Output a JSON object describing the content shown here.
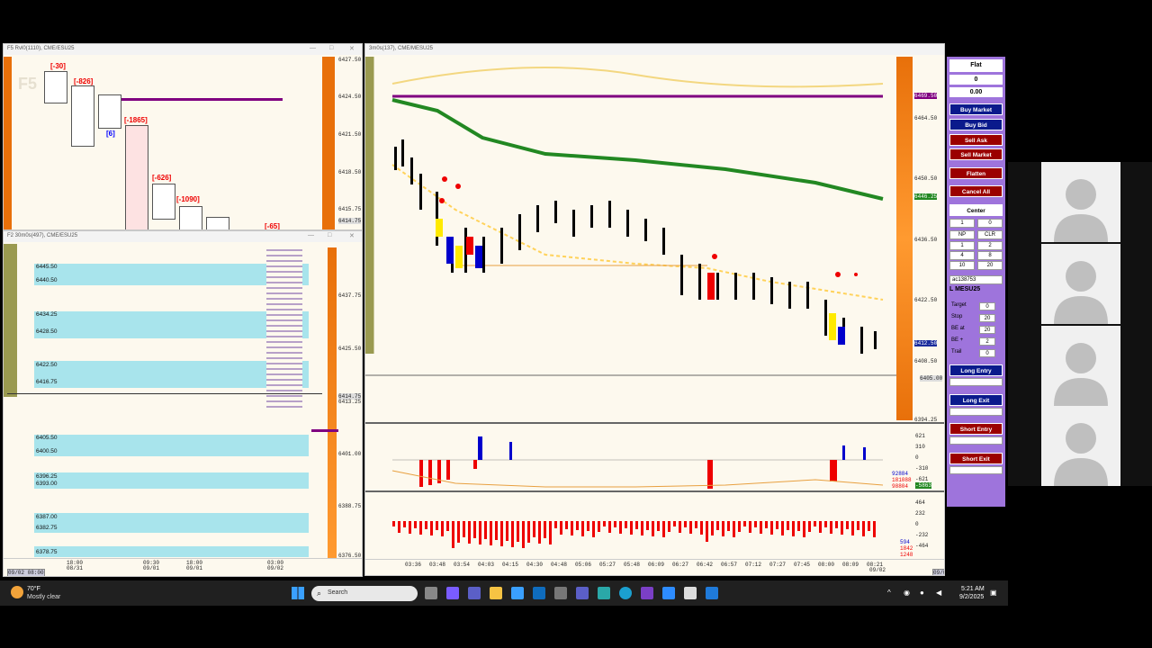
{
  "windows": {
    "left_top": {
      "title": "F5 Rvl0(1110), CME/ESU25",
      "watermark": "F5",
      "prices": [
        "6427.50",
        "6424.50",
        "6421.50",
        "6418.50",
        "6415.75",
        "6414.75"
      ],
      "labels": [
        "[-30]",
        "[-826]",
        "[-1865]",
        "[6]",
        "[-626]",
        "[-1090]",
        "[-65]"
      ]
    },
    "left_bottom": {
      "title": "F2 30m0s(497), CME/ESU25",
      "bands": [
        "6445.50",
        "6440.50",
        "6434.25",
        "6428.50",
        "6422.50",
        "6416.75",
        "6405.50",
        "6400.50",
        "6396.25",
        "6393.00",
        "6387.00",
        "6382.75",
        "6378.75"
      ],
      "prices": [
        "6437.75",
        "6425.50",
        "6414.75",
        "6413.25",
        "6401.00",
        "6388.75",
        "6376.50"
      ],
      "time_labels": [
        {
          "t": "18:00",
          "d": "08/31"
        },
        {
          "t": "09:30",
          "d": "09/01"
        },
        {
          "t": "18:00",
          "d": "09/01"
        },
        {
          "t": "03:00",
          "d": "09/02"
        }
      ],
      "date_box": "09/02 08:00"
    },
    "main": {
      "title": "3m0s(137), CME/MESU25",
      "prices": [
        "6469.50",
        "6464.50",
        "6450.50",
        "6446.25",
        "6436.50",
        "6422.50",
        "6412.50",
        "6408.50",
        "6405.00",
        "6394.25"
      ],
      "vol_axis": [
        "621",
        "310",
        "0",
        "-310",
        "-621"
      ],
      "vol_values": [
        "92884",
        "181088",
        "98804",
        "-5863"
      ],
      "delta_axis": [
        "464",
        "232",
        "0",
        "-232",
        "-464"
      ],
      "delta_values": [
        "594",
        "1842",
        "1248"
      ],
      "time_labels": [
        "03:36",
        "03:48",
        "03:54",
        "04:03",
        "04:15",
        "04:30",
        "04:48",
        "05:06",
        "05:27",
        "05:48",
        "06:09",
        "06:27",
        "06:42",
        "06:57",
        "07:12",
        "07:27",
        "07:45",
        "08:00",
        "08:09",
        "08:21"
      ],
      "date_last": "09/02",
      "date_box": "09/02 08:21"
    }
  },
  "order_panel": {
    "status": "Flat",
    "position": "0",
    "pnl": "0.00",
    "buy_market": "Buy Market",
    "buy_bid": "Buy Bid",
    "sell_ask": "Sell Ask",
    "sell_market": "Sell Market",
    "flatten": "Flatten",
    "cancel_all": "Cancel All",
    "center": "Center",
    "qty": "1",
    "qty2": "0",
    "grid": [
      "NP",
      "CLR",
      "1",
      "2",
      "4",
      "8",
      "10",
      "20"
    ],
    "account": "ac138753",
    "symbol": "L MESU25",
    "params": [
      {
        "label": "Target",
        "value": "0"
      },
      {
        "label": "Stop",
        "value": "20"
      },
      {
        "label": "BE at",
        "value": "20"
      },
      {
        "label": "BE +",
        "value": "2"
      },
      {
        "label": "Trail",
        "value": "0"
      }
    ],
    "long_entry": "Long Entry",
    "long_exit": "Long Exit",
    "short_entry": "Short Entry",
    "short_exit": "Short Exit"
  },
  "taskbar": {
    "weather_temp": "70°F",
    "weather_desc": "Mostly clear",
    "search": "Search",
    "time": "5:21 AM",
    "date": "9/2/2025"
  },
  "colors": {
    "accent_purple": "#9e74dc",
    "buy_blue": "#0a1a8c",
    "sell_red": "#9b0000",
    "band_cyan": "#a8e4ec",
    "profile_orange": "#e8700a"
  }
}
